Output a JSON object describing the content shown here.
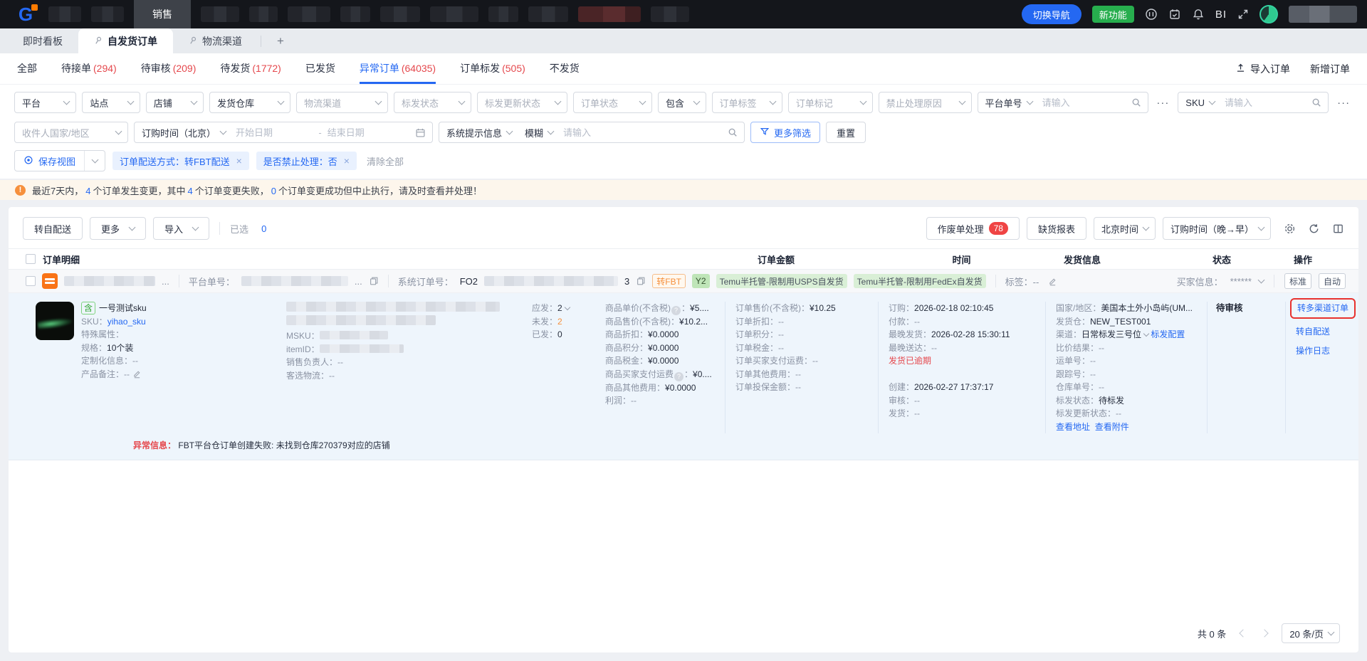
{
  "ui": {
    "colon": "：",
    "q": "?",
    "bang": "!",
    "close": "×",
    "dots": "···",
    "ellipsis": "...",
    "dash": "-"
  },
  "topbar": {
    "menu_active": "销售",
    "switch_nav": "切换导航",
    "new_feature": "新功能",
    "bi": "BI"
  },
  "tabbar": {
    "tabs": [
      {
        "label": "即时看板"
      },
      {
        "label": "自发货订单"
      },
      {
        "label": "物流渠道"
      }
    ],
    "add": "+"
  },
  "subtabs": {
    "items": [
      {
        "label": "全部",
        "count": ""
      },
      {
        "label": "待接单",
        "count": "(294)"
      },
      {
        "label": "待审核",
        "count": "(209)"
      },
      {
        "label": "待发货",
        "count": "(1772)"
      },
      {
        "label": "已发货",
        "count": ""
      },
      {
        "label": "异常订单",
        "count": "(64035)"
      },
      {
        "label": "订单标发",
        "count": "(505)"
      },
      {
        "label": "不发货",
        "count": ""
      }
    ],
    "import_btn": "导入订单",
    "create_btn": "新增订单"
  },
  "filters": {
    "row1": [
      {
        "label": "平台"
      },
      {
        "label": "站点"
      },
      {
        "label": "店铺"
      },
      {
        "label": "发货仓库"
      },
      {
        "label": "物流渠道"
      },
      {
        "label": "标发状态"
      },
      {
        "label": "标发更新状态"
      },
      {
        "label": "订单状态"
      },
      {
        "label": "包含"
      },
      {
        "label": "订单标签"
      },
      {
        "label": "订单标记"
      },
      {
        "label": "禁止处理原因"
      }
    ],
    "platform_no": {
      "label": "平台单号",
      "placeholder": "请输入"
    },
    "sku": {
      "label": "SKU",
      "placeholder": "请输入"
    },
    "row2": {
      "country": "收件人国家/地区",
      "time_type": "订购时间（北京）",
      "start": "开始日期",
      "end": "结束日期",
      "sys": "系统提示信息",
      "fuzzy": "模糊",
      "keyword_placeholder": "请输入",
      "more_filters": "更多筛选",
      "reset": "重置"
    },
    "view": {
      "save": "保存视图",
      "chips": [
        {
          "text": "订单配送方式：转FBT配送"
        },
        {
          "text": "是否禁止处理：否"
        }
      ],
      "clear": "清除全部"
    }
  },
  "banner": {
    "p1": "最近7天内，",
    "n1": "4",
    "p2": "个订单发生变更，其中",
    "n2": "4",
    "p3": "个订单变更失败，",
    "n3": "0",
    "p4": "个订单变更成功但中止执行，请及时查看并处理！"
  },
  "toolbar": {
    "to_self": "转自配送",
    "more": "更多",
    "import": "导入",
    "selected_label": "已选",
    "selected_count": "0",
    "void": "作废单处理",
    "void_count": "78",
    "oos_report": "缺货报表",
    "timezone": "北京时间",
    "sort": "订购时间（晚→早）"
  },
  "table": {
    "columns": [
      "订单明细",
      "订单金额",
      "时间",
      "发货信息",
      "状态",
      "操作"
    ]
  },
  "group": {
    "platform_label": "平台单号：",
    "system_label": "系统订单号：",
    "system_prefix": "FO2",
    "system_suffix": "3",
    "tag_fbt": "转FBT",
    "tag_y2": "Y2",
    "tag_usps": "Temu半托管-限制用USPS自发货",
    "tag_fedex": "Temu半托管-限制用FedEx自发货",
    "label_kv": "标签：--",
    "buyer_label": "买家信息：",
    "buyer_value": "******",
    "btn_standard": "标准",
    "btn_auto": "自动"
  },
  "row": {
    "product": {
      "badge": "含",
      "name": "一号测试sku",
      "sku_label": "SKU：",
      "sku": "yihao_sku",
      "attr_label": "特殊属性：",
      "attr": "",
      "spec_label": "规格：",
      "spec": "10个装",
      "custom_label": "定制化信息：",
      "custom": "--",
      "note_label": "产品备注：",
      "note": "--"
    },
    "middle": {
      "msku_label": "MSKU：",
      "itemid_label": "itemID：",
      "sales_label": "销售负责人：",
      "sales": "--",
      "logi_label": "客选物流：",
      "logi": "--"
    },
    "qty": {
      "due_label": "应发：",
      "due": "2",
      "unsent_label": "未发：",
      "unsent": "2",
      "sent_label": "已发：",
      "sent": "0"
    },
    "goods": [
      {
        "label": "商品单价(不含税)",
        "value": "¥5...."
      },
      {
        "label": "商品售价(不含税)",
        "value": "¥10.2..."
      },
      {
        "label": "商品折扣",
        "value": "¥0.0000"
      },
      {
        "label": "商品积分",
        "value": "¥0.0000"
      },
      {
        "label": "商品税金",
        "value": "¥0.0000"
      },
      {
        "label": "商品买家支付运费",
        "value": "¥0...."
      },
      {
        "label": "商品其他费用",
        "value": "¥0.0000"
      },
      {
        "label": "利润",
        "value": "--"
      }
    ],
    "order_amounts": [
      {
        "label": "订单售价(不含税)：",
        "value": "¥10.25"
      },
      {
        "label": "订单折扣：",
        "value": "--"
      },
      {
        "label": "订单积分：",
        "value": "--"
      },
      {
        "label": "订单税金：",
        "value": "--"
      },
      {
        "label": "订单买家支付运费：",
        "value": "--"
      },
      {
        "label": "订单其他费用：",
        "value": "--"
      },
      {
        "label": "订单投保金额：",
        "value": "--"
      }
    ],
    "time": {
      "l1": [
        {
          "label": "订购：",
          "value": "2026-02-18 02:10:45"
        },
        {
          "label": "付款：",
          "value": "--"
        },
        {
          "label": "最晚发货：",
          "value": "2026-02-28 15:30:11"
        },
        {
          "label": "最晚送达：",
          "value": "--"
        }
      ],
      "overdue": "发货已逾期",
      "l2": [
        {
          "label": "创建：",
          "value": "2026-02-27 17:37:17"
        },
        {
          "label": "审核：",
          "value": "--"
        },
        {
          "label": "发货：",
          "value": "--"
        }
      ]
    },
    "ship": {
      "country_label": "国家/地区：",
      "country": "美国本土外小岛屿(UM...",
      "wh_label": "发货仓：",
      "wh": "NEW_TEST001",
      "ch_label": "渠道：",
      "ch": "日常标发三号位",
      "ch_cfg": "标发配置",
      "rest": [
        {
          "label": "比价结果：",
          "value": "--"
        },
        {
          "label": "运单号：",
          "value": "--"
        },
        {
          "label": "跟踪号：",
          "value": "--"
        },
        {
          "label": "仓库单号：",
          "value": "--"
        },
        {
          "label": "标发状态：",
          "value": "待标发"
        },
        {
          "label": "标发更新状态：",
          "value": "--"
        }
      ],
      "link_addr": "查看地址",
      "link_attach": "查看附件"
    },
    "status": "待审核",
    "ops": [
      {
        "label": "转多渠道订单"
      },
      {
        "label": "转自配送"
      },
      {
        "label": "操作日志"
      }
    ],
    "error_label": "异常信息：",
    "error_text": "FBT平台仓订单创建失败: 未找到仓库270379对应的店铺"
  },
  "footer": {
    "total": "共 0 条",
    "page_size": "20 条/页"
  }
}
